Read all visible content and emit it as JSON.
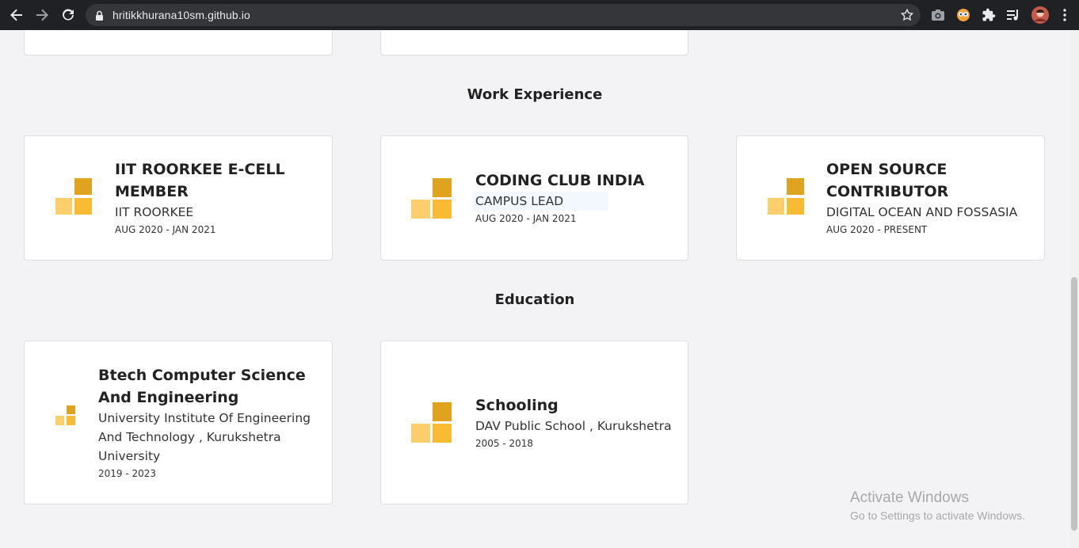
{
  "browser": {
    "url": "hritikkhurana10sm.github.io",
    "icons": [
      "back-arrow-icon",
      "forward-arrow-icon",
      "reload-icon",
      "lock-icon",
      "star-icon",
      "camera-icon",
      "extension-eyes-icon",
      "puzzle-icon",
      "media-queue-icon",
      "profile-avatar",
      "more-vert-icon"
    ]
  },
  "sections": {
    "work_title": "Work Experience",
    "education_title": "Education"
  },
  "work": [
    {
      "title_line1": "IIT ROORKEE E-CELL",
      "title_line2": "MEMBER",
      "subtitle": "IIT ROORKEE",
      "dates": "AUG 2020 - JAN 2021"
    },
    {
      "title_line1": "CODING CLUB INDIA",
      "subtitle": "CAMPUS LEAD",
      "dates": "AUG 2020 - JAN 2021"
    },
    {
      "title_line1": "OPEN SOURCE",
      "title_line2": "CONTRIBUTOR",
      "subtitle": "DIGITAL OCEAN AND FOSSASIA",
      "dates": "AUG 2020 - PRESENT"
    }
  ],
  "education": [
    {
      "title_line1": "Btech Computer Science",
      "title_line2": "And Engineering",
      "sub_line1": "University Institute Of Engineering",
      "sub_line2": "And Technology , Kurukshetra",
      "sub_line3": "University",
      "dates": "2019 - 2023"
    },
    {
      "title_line1": "Schooling",
      "subtitle": "DAV Public School , Kurukshetra",
      "dates": "2005 - 2018"
    }
  ],
  "watermark": {
    "line1": "Activate Windows",
    "line2": "Go to Settings to activate Windows."
  },
  "colors": {
    "logo_dark": "#e0a320",
    "logo_light": "#fcce6c",
    "logo_mid": "#f9bb34",
    "page_bg": "#f3f2f5"
  }
}
